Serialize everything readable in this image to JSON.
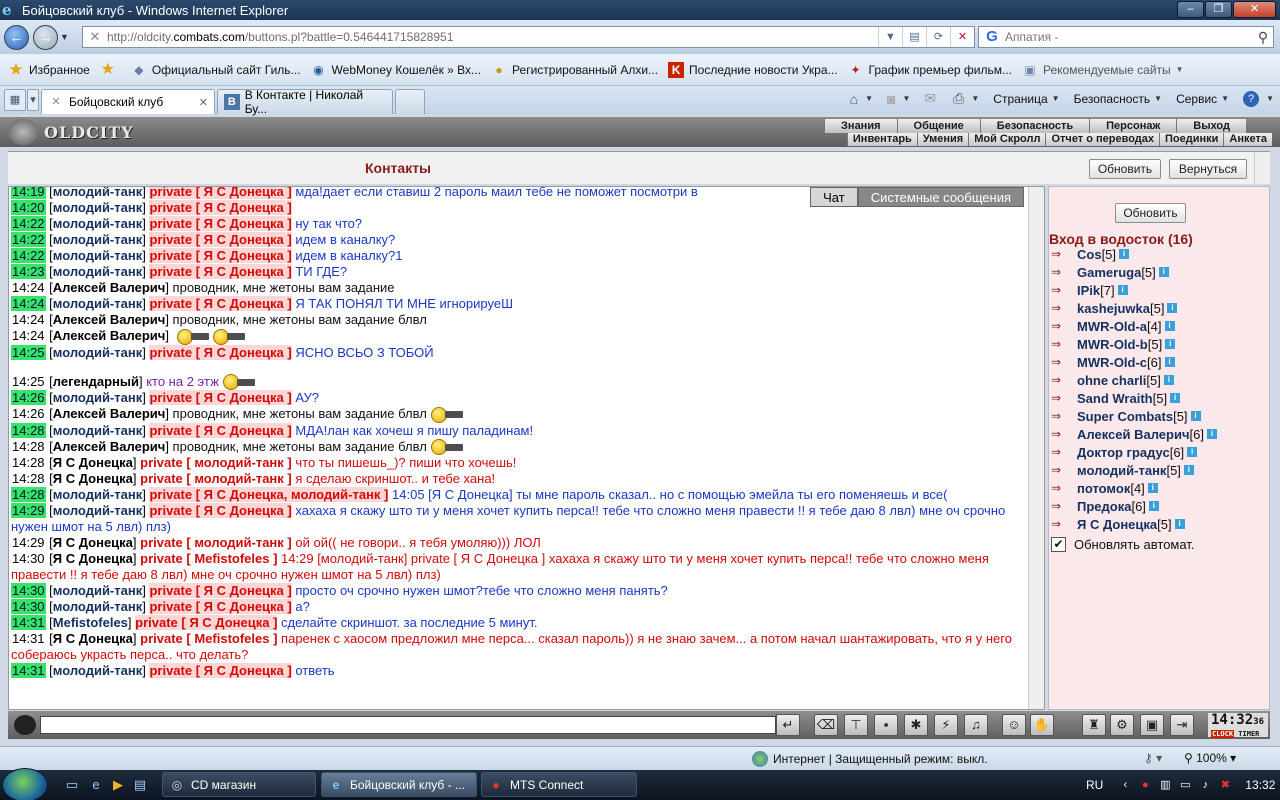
{
  "window": {
    "title": "Бойцовский клуб - Windows Internet Explorer"
  },
  "address": {
    "url_prefix": "http://oldcity.",
    "url_domain": "combats.com",
    "url_suffix": "/buttons.pl?battle=0.546441715828951"
  },
  "search": {
    "value": "Аппатия -"
  },
  "favorites": {
    "label": "Избранное",
    "items": [
      "Официальный сайт Гиль...",
      "WebMoney Кошелёк » Вх...",
      "Регистрированный Алхи...",
      "Последние новости Укра...",
      "График премьер фильм...",
      "Рекомендуемые сайты"
    ]
  },
  "tabs": [
    "Бойцовский клуб",
    "В Контакте | Николай Бу..."
  ],
  "commands": [
    "Страница",
    "Безопасность",
    "Сервис"
  ],
  "game": {
    "logo": "OLDCITY",
    "menu1": [
      "Знания",
      "Общение",
      "Безопасность",
      "Персонаж",
      "Выход"
    ],
    "menu2": [
      "Инвентарь",
      "Умения",
      "Мой Скролл",
      "Отчет о переводах",
      "Поединки",
      "Анкета"
    ],
    "contacts_title": "Контакты",
    "refresh": "Обновить",
    "back": "Вернуться"
  },
  "chat_tabs": [
    "Чат",
    "Системные сообщения"
  ],
  "chat": [
    {
      "t": "14:19",
      "g": true,
      "nick": "молодий-танк",
      "priv": "private [ Я С Донецка ]",
      "msg": "мда!дает если ставиш 2 пароль маил тебе не поможет посмотри в",
      "mc": "blue"
    },
    {
      "t": "14:20",
      "g": true,
      "nick": "молодий-танк",
      "priv": "private [ Я С Донецка ]",
      "msg": "",
      "mc": "blue"
    },
    {
      "t": "14:22",
      "g": true,
      "nick": "молодий-танк",
      "priv": "private [ Я С Донецка ]",
      "msg": "ну так что?",
      "mc": "blue"
    },
    {
      "t": "14:22",
      "g": true,
      "nick": "молодий-танк",
      "priv": "private [ Я С Донецка ]",
      "msg": "идем в каналку?",
      "mc": "blue"
    },
    {
      "t": "14:22",
      "g": true,
      "nick": "молодий-танк",
      "priv": "private [ Я С Донецка ]",
      "msg": "идем в каналку?1",
      "mc": "blue"
    },
    {
      "t": "14:23",
      "g": true,
      "nick": "молодий-танк",
      "priv": "private [ Я С Донецка ]",
      "msg": "ТИ ГДЕ?",
      "mc": "blue"
    },
    {
      "t": "14:24",
      "g": false,
      "nick": "Алексей Валерич",
      "priv": "",
      "msg": "проводник, мне жетоны вам задание",
      "mc": "black"
    },
    {
      "t": "14:24",
      "g": true,
      "nick": "молодий-танк",
      "priv": "private [ Я С Донецка ]",
      "msg": "Я ТАК ПОНЯЛ ТИ МНЕ игнорируеШ",
      "mc": "blue"
    },
    {
      "t": "14:24",
      "g": false,
      "nick": "Алексей Валерич",
      "priv": "",
      "msg": "проводник, мне жетоны вам задание блвл",
      "mc": "black"
    },
    {
      "t": "14:24",
      "g": false,
      "nick": "Алексей Валерич",
      "priv": "",
      "msg": "",
      "mc": "black",
      "smiles": 2
    },
    {
      "t": "14:25",
      "g": true,
      "nick": "молодий-танк",
      "priv": "private [ Я С Донецка ]",
      "msg": "ЯСНО ВСЬО З ТОБОЙ",
      "mc": "blue"
    },
    {
      "t": "",
      "g": false,
      "nick": "",
      "priv": "",
      "msg": "",
      "mc": "black"
    },
    {
      "t": "14:25",
      "g": false,
      "nick": "легендарный",
      "priv": "",
      "msg": "кто на 2 этж",
      "mc": "purple",
      "smiles": 1
    },
    {
      "t": "14:26",
      "g": true,
      "nick": "молодий-танк",
      "priv": "private [ Я С Донецка ]",
      "msg": "АУ?",
      "mc": "blue"
    },
    {
      "t": "14:26",
      "g": false,
      "nick": "Алексей Валерич",
      "priv": "",
      "msg": "проводник, мне жетоны вам задание блвл",
      "mc": "black",
      "smiles": 1
    },
    {
      "t": "14:28",
      "g": true,
      "nick": "молодий-танк",
      "priv": "private [ Я С Донецка ]",
      "msg": "МДА!лан как хочеш я пишу паладинам!",
      "mc": "blue"
    },
    {
      "t": "14:28",
      "g": false,
      "nick": "Алексей Валерич",
      "priv": "",
      "msg": "проводник, мне жетоны вам задание блвл",
      "mc": "black",
      "smiles": 1
    },
    {
      "t": "14:28",
      "g": false,
      "nick": "Я С Донецка",
      "priv": "private [ молодий-танк ]",
      "msg": "что ты пишешь_)? пиши что хочешь!",
      "mc": "red"
    },
    {
      "t": "14:28",
      "g": false,
      "nick": "Я С Донецка",
      "priv": "private [ молодий-танк ]",
      "msg": "я сделаю скриншот.. и тебе хана!",
      "mc": "red"
    },
    {
      "t": "14:28",
      "g": true,
      "nick": "молодий-танк",
      "priv": "private [ Я С Донецка, молодий-танк ]",
      "msg": "14:05 [Я С Донецка] ты мне пароль сказал.. но с помощью эмейла ты его поменяешь и все(",
      "mc": "blue"
    },
    {
      "t": "14:29",
      "g": true,
      "nick": "молодий-танк",
      "priv": "private [ Я С Донецка ]",
      "msg": "хахаха я скажу што ти у меня хочет купить перса!! тебе что сложно меня правести !! я тебе даю 8 лвл) мне оч срочно нужен шмот на 5 лвл) плз)",
      "mc": "blue"
    },
    {
      "t": "14:29",
      "g": false,
      "nick": "Я С Донецка",
      "priv": "private [ молодий-танк ]",
      "msg": "ой ой(( не говори.. я тебя умоляю))) ЛОЛ",
      "mc": "red"
    },
    {
      "t": "14:30",
      "g": false,
      "nick": "Я С Донецка",
      "priv": "private [ Mefistofeles ]",
      "msg": "14:29 [молодий-танк] private [ Я С Донецка ] хахаха я скажу што ти у меня хочет купить перса!! тебе что сложно меня правести !! я тебе даю 8 лвл) мне оч срочно нужен шмот на 5 лвл) плз)",
      "mc": "red"
    },
    {
      "t": "14:30",
      "g": true,
      "nick": "молодий-танк",
      "priv": "private [ Я С Донецка ]",
      "msg": "просто оч срочно нужен шмот?тебе что сложно меня панять?",
      "mc": "blue"
    },
    {
      "t": "14:30",
      "g": true,
      "nick": "молодий-танк",
      "priv": "private [ Я С Донецка ]",
      "msg": "а?",
      "mc": "blue"
    },
    {
      "t": "14:31",
      "g": true,
      "nick": "Mefistofeles",
      "priv": "private [ Я С Донецка ]",
      "msg": "сделайте скриншот. за последние 5 минут.",
      "mc": "blue"
    },
    {
      "t": "14:31",
      "g": false,
      "nick": "Я С Донецка",
      "priv": "private [ Mefistofeles ]",
      "msg": "паренек с хаосом предложил мне перса... сказал пароль)) я не знаю зачем... а потом начал шантажировать, что я у него собераюсь украсть перса.. что делать?",
      "mc": "red"
    },
    {
      "t": "14:31",
      "g": true,
      "nick": "молодий-танк",
      "priv": "private [ Я С Донецка ]",
      "msg": "ответь",
      "mc": "blue"
    }
  ],
  "side": {
    "refresh": "Обновить",
    "heading": "Вход в водосток (16)",
    "players": [
      {
        "name": "Cos",
        "level": "[5]"
      },
      {
        "name": "Gameruga",
        "level": "[5]"
      },
      {
        "name": "IPik",
        "level": "[7]"
      },
      {
        "name": "kashejuwka",
        "level": "[5]"
      },
      {
        "name": "MWR-Old-a",
        "level": "[4]"
      },
      {
        "name": "MWR-Old-b",
        "level": "[5]"
      },
      {
        "name": "MWR-Old-c",
        "level": "[6]"
      },
      {
        "name": "ohne charli",
        "level": "[5]"
      },
      {
        "name": "Sand Wraith",
        "level": "[5]"
      },
      {
        "name": "Super Combats",
        "level": "[5]"
      },
      {
        "name": "Алексей Валерич",
        "level": "[6]"
      },
      {
        "name": "Доктор градус",
        "level": "[6]"
      },
      {
        "name": "молодий-танк",
        "level": "[5]"
      },
      {
        "name": "потомок",
        "level": "[4]"
      },
      {
        "name": "Предока",
        "level": "[6]"
      },
      {
        "name": "Я С Донецка",
        "level": "[5]"
      }
    ],
    "auto_refresh": "Обновлять автомат."
  },
  "clock": {
    "time": "14:32",
    "secs": "36",
    "clock_label": "CLOCK",
    "timer_label": "TIMER"
  },
  "status": {
    "zone": "Интернет | Защищенный режим: выкл.",
    "zoom": "100%"
  },
  "taskbar": {
    "tasks": [
      "CD магазин",
      "Бойцовский клуб - ...",
      "MTS Connect"
    ],
    "lang": "RU",
    "time": "13:32"
  }
}
